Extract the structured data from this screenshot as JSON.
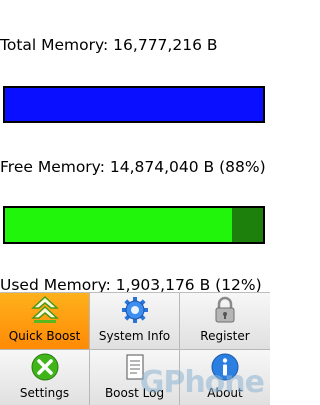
{
  "stats": {
    "total_label": "Total Memory: 16,777,216 B",
    "free_label": "Free Memory: 14,874,040 B (88%)",
    "used_label": "Used Memory: 1,903,176 B (12%)",
    "free_fraction": 0.88
  },
  "colors": {
    "total_bar": "#0a10ff",
    "free_bar": "#22f50c",
    "used_portion": "#1d7f0c",
    "active_menu": "#ff9a10"
  },
  "menu": {
    "items": [
      {
        "label": "Quick Boost",
        "icon": "double-chevron-up-icon",
        "active": true
      },
      {
        "label": "System Info",
        "icon": "gear-icon",
        "active": false
      },
      {
        "label": "Register",
        "icon": "lock-icon",
        "active": false
      },
      {
        "label": "Settings",
        "icon": "x-circle-icon",
        "active": false
      },
      {
        "label": "Boost Log",
        "icon": "document-icon",
        "active": false
      },
      {
        "label": "About",
        "icon": "info-icon",
        "active": false
      }
    ]
  },
  "watermark": {
    "text": "GPhone"
  }
}
